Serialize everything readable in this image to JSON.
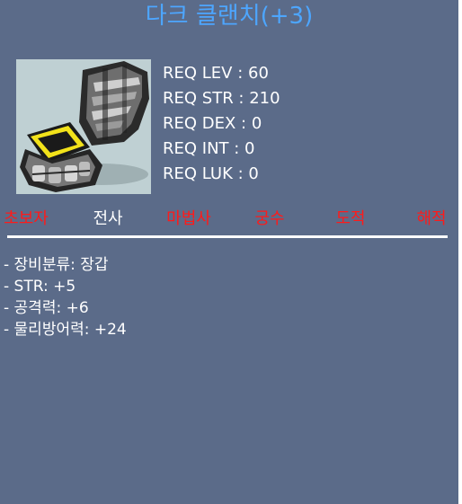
{
  "item": {
    "title": "다크 클랜치(+3)",
    "icon": "gauntlet-icon"
  },
  "requirements": [
    {
      "label": "REQ LEV : 60"
    },
    {
      "label": "REQ STR : 210"
    },
    {
      "label": "REQ DEX : 0"
    },
    {
      "label": "REQ INT : 0"
    },
    {
      "label": "REQ LUK : 0"
    }
  ],
  "jobs": [
    {
      "label": "초보자",
      "color": "#ff1a1a",
      "allowed": false
    },
    {
      "label": "전사",
      "color": "#ffffff",
      "allowed": true
    },
    {
      "label": "마법사",
      "color": "#ff1a1a",
      "allowed": false
    },
    {
      "label": "궁수",
      "color": "#ff1a1a",
      "allowed": false
    },
    {
      "label": "도적",
      "color": "#ff1a1a",
      "allowed": false
    },
    {
      "label": "해적",
      "color": "#ff1a1a",
      "allowed": false
    }
  ],
  "stats": [
    {
      "label": "- 장비분류: 장갑"
    },
    {
      "label": "- STR: +5"
    },
    {
      "label": "- 공격력: +6"
    },
    {
      "label": "- 물리방어력: +24"
    }
  ],
  "colors": {
    "panel_bg": "#5b6b89",
    "title": "#4da6ff",
    "icon_bg": "#bfd0d3",
    "divider": "#ffffff"
  }
}
